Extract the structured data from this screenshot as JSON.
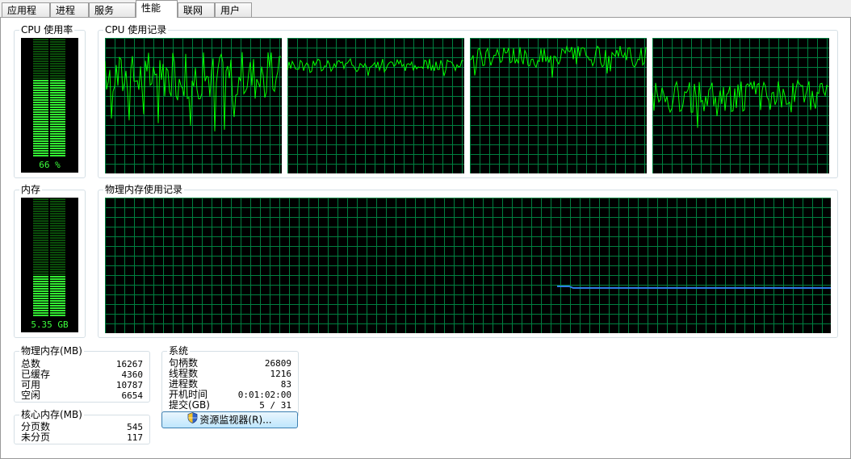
{
  "tabs": [
    {
      "label": "应用程序",
      "active": false
    },
    {
      "label": "进程",
      "active": false
    },
    {
      "label": "服务",
      "active": false
    },
    {
      "label": "性能",
      "active": true
    },
    {
      "label": "联网",
      "active": false
    },
    {
      "label": "用户",
      "active": false
    }
  ],
  "cpu_usage": {
    "title": "CPU 使用率",
    "percent": 66,
    "display": "66 %"
  },
  "cpu_history": {
    "title": "CPU 使用记录",
    "cores": 4
  },
  "memory": {
    "title": "内存",
    "display": "5.35 GB",
    "fraction": 0.34
  },
  "memory_history": {
    "title": "物理内存使用记录"
  },
  "physical_memory": {
    "title": "物理内存(MB)",
    "rows": [
      {
        "label": "总数",
        "value": "16267"
      },
      {
        "label": "已缓存",
        "value": "4360"
      },
      {
        "label": "可用",
        "value": "10787"
      },
      {
        "label": "空闲",
        "value": "6654"
      }
    ]
  },
  "kernel_memory": {
    "title": "核心内存(MB)",
    "rows": [
      {
        "label": "分页数",
        "value": "545"
      },
      {
        "label": "未分页",
        "value": "117"
      }
    ]
  },
  "system": {
    "title": "系统",
    "rows": [
      {
        "label": "句柄数",
        "value": "26809"
      },
      {
        "label": "线程数",
        "value": "1216"
      },
      {
        "label": "进程数",
        "value": "83"
      },
      {
        "label": "开机时间",
        "value": "0:01:02:00"
      },
      {
        "label": "提交(GB)",
        "value": "5 / 31"
      }
    ]
  },
  "resource_monitor_button": {
    "label": "资源监视器(R)..."
  },
  "colors": {
    "grid": "#008040",
    "line": "#00ff00",
    "meter_on": "#33ee33",
    "meter_off": "#0a4d0a",
    "mem_line": "#2e7ce6"
  }
}
